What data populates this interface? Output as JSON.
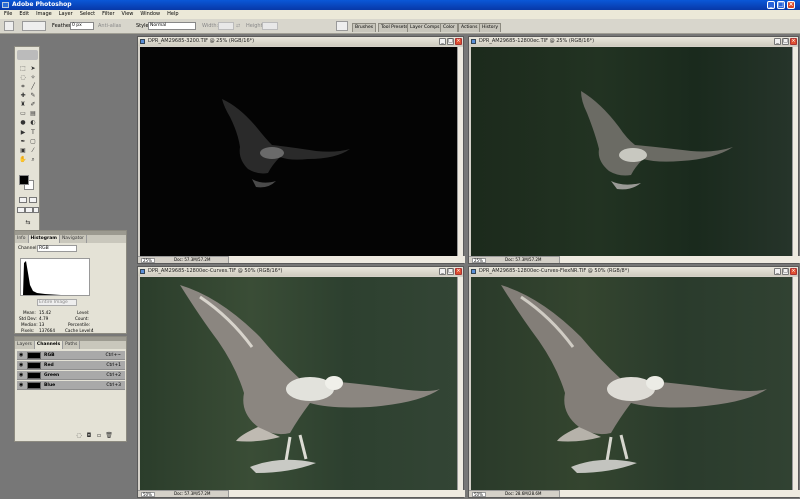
{
  "app": {
    "title": "Adobe Photoshop"
  },
  "menu": [
    "File",
    "Edit",
    "Image",
    "Layer",
    "Select",
    "Filter",
    "View",
    "Window",
    "Help"
  ],
  "options": {
    "feather_label": "Feather:",
    "feather_value": "0 px",
    "antialiased_label": "Anti-alias",
    "style_label": "Style:",
    "style_value": "Normal",
    "width_label": "Width:",
    "height_label": "Height:"
  },
  "palette_well": [
    "Brushes",
    "Tool Presets",
    "Layer Comps",
    "Color",
    "Actions",
    "History"
  ],
  "panels": {
    "histogram": {
      "tabs": [
        "Info",
        "Histogram",
        "Navigator"
      ],
      "channel_label": "Channel:",
      "channel_value": "RGB",
      "source_value": "Entire Image",
      "stats": {
        "mean_label": "Mean:",
        "mean_value": "15.42",
        "stddev_label": "Std Dev:",
        "stddev_value": "4.79",
        "median_label": "Median:",
        "median_value": "13",
        "pixels_label": "Pixels:",
        "pixels_value": "137664",
        "level_label": "Level:",
        "count_label": "Count:",
        "percentile_label": "Percentile:",
        "cache_label": "Cache Level:",
        "cache_value": "4"
      }
    },
    "channels": {
      "tabs": [
        "Layers",
        "Channels",
        "Paths"
      ],
      "rows": [
        {
          "name": "RGB",
          "shortcut": "Ctrl+~"
        },
        {
          "name": "Red",
          "shortcut": "Ctrl+1"
        },
        {
          "name": "Green",
          "shortcut": "Ctrl+2"
        },
        {
          "name": "Blue",
          "shortcut": "Ctrl+3"
        }
      ]
    }
  },
  "documents": [
    {
      "title": "DPR_AM29685-3200.TIF @ 25% (RGB/16*)",
      "zoom": "25%",
      "doc": "Doc: 57.3M/57.2M",
      "brightness": "dark"
    },
    {
      "title": "DPR_AM29685-12800ec.TIF @ 25% (RGB/16*)",
      "zoom": "25%",
      "doc": "Doc: 57.3M/57.2M",
      "brightness": "medium"
    },
    {
      "title": "DPR_AM29685-12800ec-Curves.TIF @ 50% (RGB/16*)",
      "zoom": "50%",
      "doc": "Doc: 57.3M/57.2M",
      "brightness": "bright"
    },
    {
      "title": "DPR_AM29685-12800ec-Curves-FlexNR.TIF @ 50% (RGB/8*)",
      "zoom": "50%",
      "doc": "Doc: 28.6M/28.6M",
      "brightness": "bright"
    }
  ],
  "colors": {
    "titlebar": "#0a58d8",
    "close": "#e05030"
  }
}
